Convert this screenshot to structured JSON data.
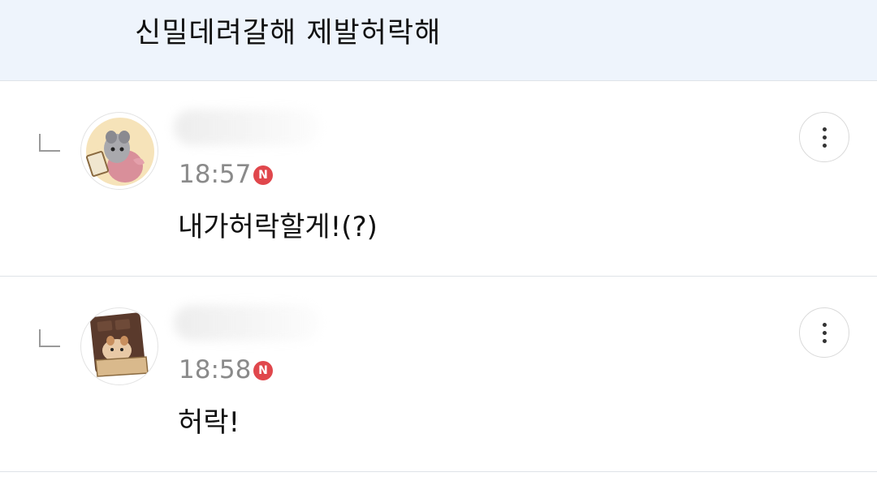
{
  "parent": {
    "text": "신밀데려갈해 제발허락해"
  },
  "replies": [
    {
      "avatar_icon": "hamster-with-sign-avatar",
      "time": "18:57",
      "badge": "N",
      "text": "내가허락할게!(?)"
    },
    {
      "avatar_icon": "cat-in-chocolate-box-avatar",
      "time": "18:58",
      "badge": "N",
      "text": "허락!"
    }
  ],
  "colors": {
    "parent_bg": "#eef4fc",
    "badge": "#e0474c",
    "time": "#8a8a8a",
    "divider": "#dfe3e8"
  }
}
